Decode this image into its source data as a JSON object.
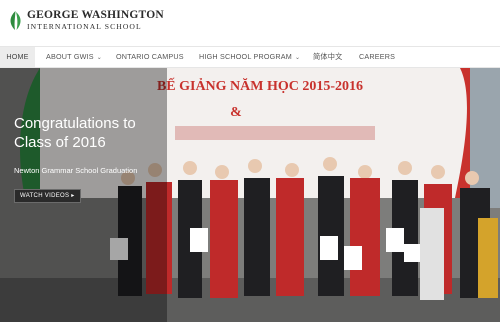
{
  "logo": {
    "line1": "GEORGE WASHINGTON",
    "line2": "INTERNATIONAL SCHOOL",
    "brand_color": "#2e8b3e"
  },
  "nav": {
    "items": [
      {
        "label": "HOME",
        "active": true,
        "has_dropdown": false
      },
      {
        "label": "ABOUT GWIS",
        "active": false,
        "has_dropdown": true
      },
      {
        "label": "ONTARIO CAMPUS",
        "active": false,
        "has_dropdown": false
      },
      {
        "label": "HIGH SCHOOL PROGRAM",
        "active": false,
        "has_dropdown": true
      },
      {
        "label": "简体中文",
        "active": false,
        "has_dropdown": false
      },
      {
        "label": "CAREERS",
        "active": false,
        "has_dropdown": false
      }
    ],
    "caret": "⌄"
  },
  "hero": {
    "title": "Congratulations to Class of 2016",
    "subtitle": "Newton Grammar School Graduation",
    "button_label": "WATCH VIDEOS",
    "button_icon": "play-icon",
    "banner_line1": "BẾ GIẢNG NĂM HỌC 2015-2016",
    "banner_amp": "&",
    "banner_accent_color": "#c8322d"
  }
}
